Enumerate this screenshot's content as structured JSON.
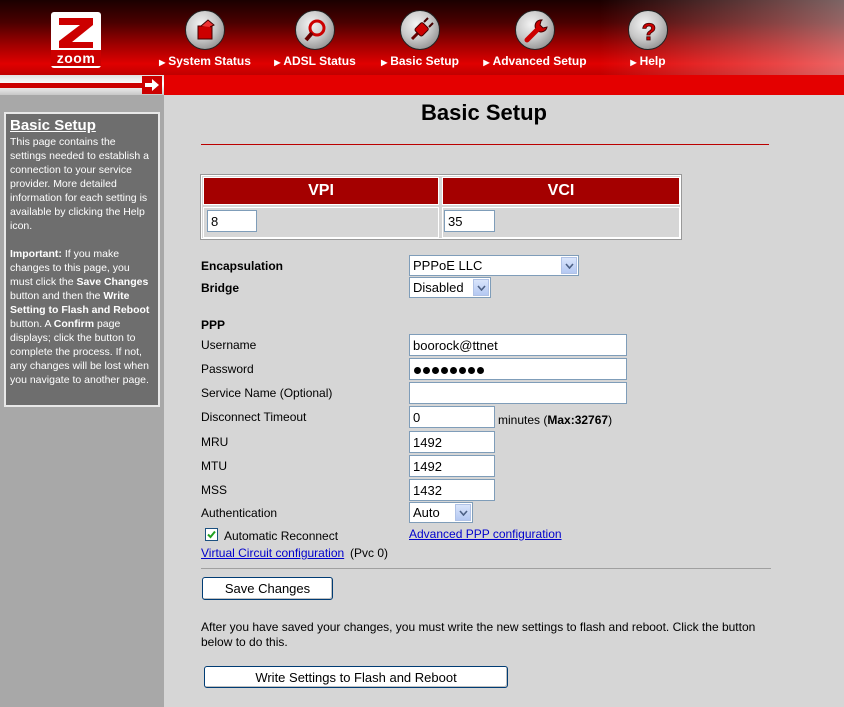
{
  "header": {
    "logo_text": "zoom",
    "nav": [
      {
        "label": "System Status",
        "icon": "status-icon"
      },
      {
        "label": "ADSL Status",
        "icon": "magnifier-icon"
      },
      {
        "label": "Basic Setup",
        "icon": "plug-icon"
      },
      {
        "label": "Advanced Setup",
        "icon": "wrench-icon"
      },
      {
        "label": "Help",
        "icon": "question-icon"
      }
    ]
  },
  "help": {
    "title": "Basic Setup",
    "para1": "This page contains the settings needed to establish a connection to your service provider. More detailed information for each setting is available by clicking the Help icon.",
    "important_label": "Important:",
    "p2_a": " If you make changes to this page, you must click the ",
    "p2_save": "Save Changes",
    "p2_b": " button and then the ",
    "p2_write": "Write Setting to Flash and Reboot",
    "p2_c": " button. A ",
    "p2_confirm": "Confirm",
    "p2_d": " page displays; click the button to complete the process. If not, any changes will be lost when you navigate to another page."
  },
  "main": {
    "title": "Basic Setup",
    "vpi_label": "VPI",
    "vci_label": "VCI",
    "vpi_value": "8",
    "vci_value": "35",
    "encapsulation_label": "Encapsulation",
    "encapsulation_value": "PPPoE LLC",
    "bridge_label": "Bridge",
    "bridge_value": "Disabled",
    "ppp_section": "PPP",
    "username_label": "Username",
    "username_value": "boorock@ttnet",
    "password_label": "Password",
    "password_dots": 8,
    "service_label": "Service Name (Optional)",
    "service_value": "",
    "disconnect_label": "Disconnect Timeout",
    "disconnect_value": "0",
    "minutes_label": "minutes (",
    "max_label": "Max:32767",
    "close_paren": ")",
    "mru_label": "MRU",
    "mru_value": "1492",
    "mtu_label": "MTU",
    "mtu_value": "1492",
    "mss_label": "MSS",
    "mss_value": "1432",
    "auth_label": "Authentication",
    "auth_value": "Auto",
    "auto_reconnect_label": "Automatic Reconnect",
    "auto_reconnect_checked": true,
    "advanced_ppp_link": "Advanced PPP configuration",
    "vc_link": "Virtual Circuit configuration",
    "pvc_label": "(Pvc 0)",
    "save_button": "Save Changes",
    "note": "After you have saved your changes, you must write the new settings to flash and reboot. Click the button below to do this.",
    "write_button": "Write Settings to Flash and Reboot"
  },
  "colors": {
    "header_red": "#e40000",
    "table_head": "#a40000",
    "link": "#0000cc"
  }
}
